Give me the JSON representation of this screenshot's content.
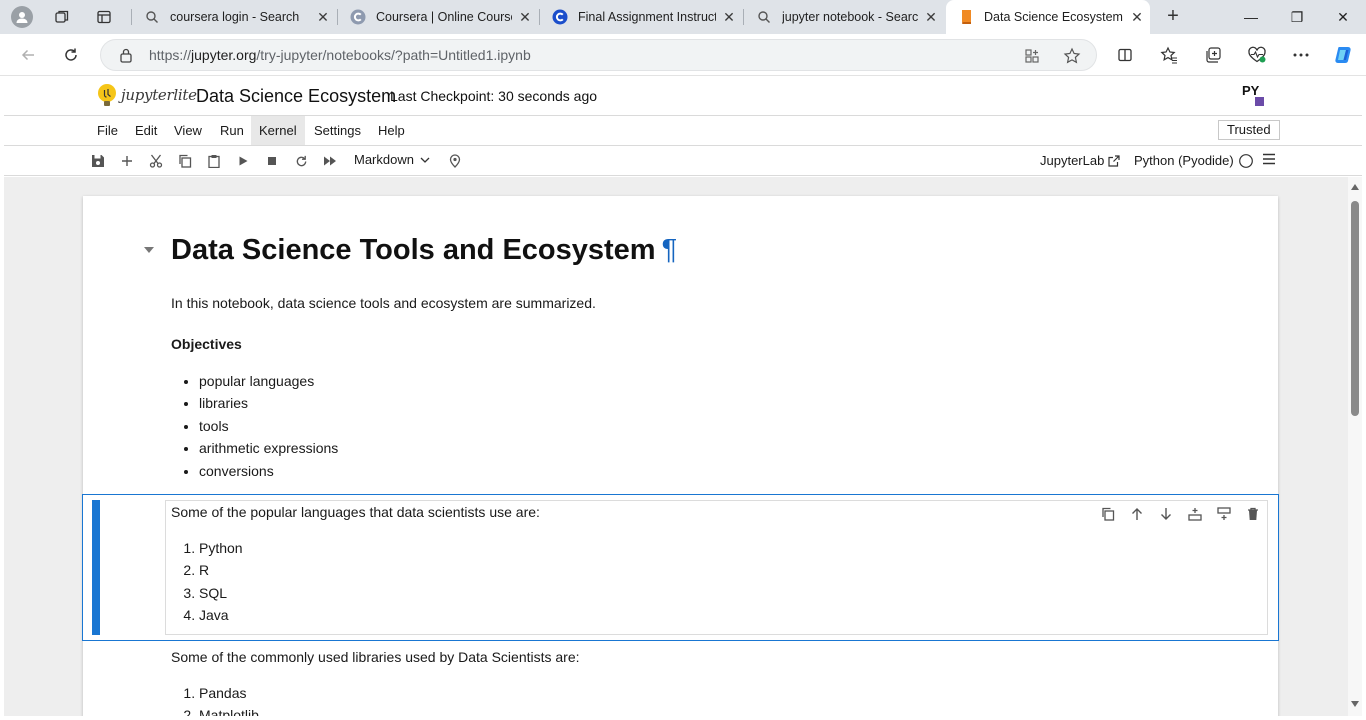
{
  "browser": {
    "tabs": [
      {
        "title": "coursera login - Search",
        "icon": "search-icon"
      },
      {
        "title": "Coursera | Online Courses & C",
        "icon": "coursera-icon"
      },
      {
        "title": "Final Assignment Instructions",
        "icon": "coursera-icon"
      },
      {
        "title": "jupyter notebook - Search",
        "icon": "search-icon"
      },
      {
        "title": "Data Science Ecosystem",
        "icon": "notebook-icon",
        "active": true
      }
    ],
    "close_glyph": "✕",
    "new_tab_glyph": "+",
    "url_prefix": "https://",
    "url_host": "jupyter.org",
    "url_path": "/try-jupyter/notebooks/?path=Untitled1.ipynb",
    "window_controls": {
      "minimize": "—",
      "restore": "❐",
      "close": "✕"
    }
  },
  "header": {
    "logo_text": "jupyterlite",
    "notebook_title": "Data Science Ecosystem",
    "checkpoint": "Last Checkpoint: 30 seconds ago",
    "py_logo_text": "PY"
  },
  "menu": [
    "File",
    "Edit",
    "View",
    "Run",
    "Kernel",
    "Settings",
    "Help"
  ],
  "trusted": "Trusted",
  "toolbar": {
    "cell_type": "Markdown",
    "jupyterlab_link": "JupyterLab",
    "kernel": "Python (Pyodide)"
  },
  "cells": {
    "heading": "Data Science Tools and Ecosystem",
    "pilcrow": "¶",
    "intro": "In this notebook, data science tools and ecosystem are summarized.",
    "objectives_label": "Objectives",
    "objectives": [
      "popular languages",
      "libraries",
      "tools",
      "arithmetic expressions",
      "conversions"
    ],
    "languages_intro": "Some of the popular languages that data scientists use are:",
    "languages": [
      "Python",
      "R",
      "SQL",
      "Java"
    ],
    "libraries_intro": "Some of the commonly used libraries used by Data Scientists are:",
    "libraries": [
      "Pandas",
      "Matplotlib"
    ]
  },
  "colors": {
    "accent": "#1976d2",
    "tab_strip": "#dfe3e8",
    "notebook_bg": "#eeeeee"
  }
}
